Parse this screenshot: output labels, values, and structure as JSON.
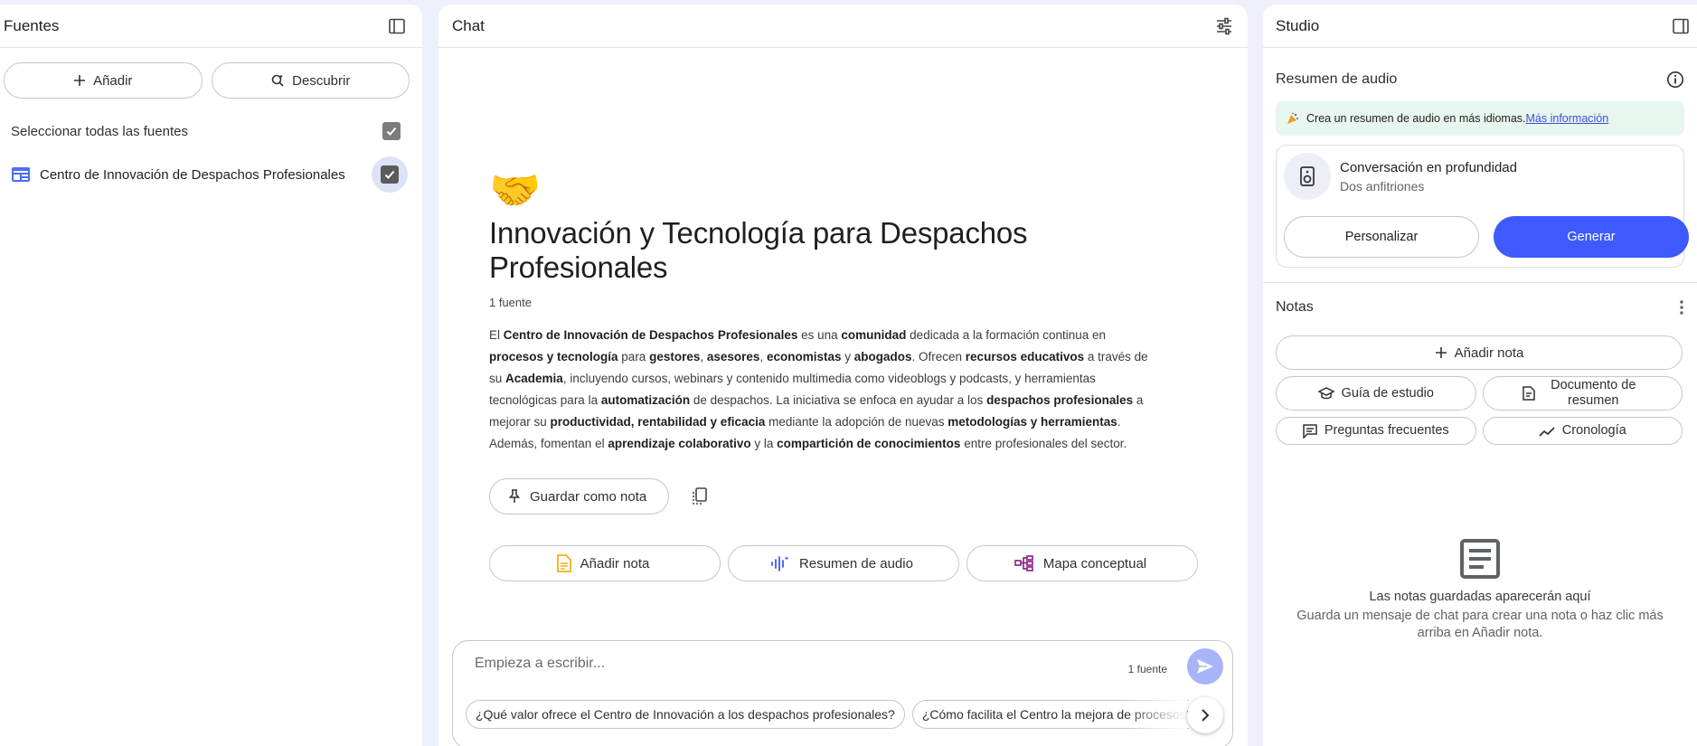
{
  "sources": {
    "title": "Fuentes",
    "add_label": "Añadir",
    "discover_label": "Descubrir",
    "select_all_label": "Seleccionar todas las fuentes",
    "items": [
      {
        "label": "Centro de Innovación de Despachos Profesionales",
        "checked": true
      }
    ]
  },
  "chat": {
    "title": "Chat",
    "emoji": "🤝",
    "notebook_title": "Innovación y Tecnología para Despachos Profesionales",
    "source_count": "1 fuente",
    "summary": [
      {
        "t": "El ",
        "b": false
      },
      {
        "t": "Centro de Innovación de Despachos Profesionales",
        "b": true
      },
      {
        "t": " es una ",
        "b": false
      },
      {
        "t": "comunidad",
        "b": true
      },
      {
        "t": " dedicada a la formación continua en ",
        "b": false
      },
      {
        "t": "procesos y tecnología",
        "b": true
      },
      {
        "t": " para ",
        "b": false
      },
      {
        "t": "gestores",
        "b": true
      },
      {
        "t": ", ",
        "b": false
      },
      {
        "t": "asesores",
        "b": true
      },
      {
        "t": ", ",
        "b": false
      },
      {
        "t": "economistas",
        "b": true
      },
      {
        "t": " y ",
        "b": false
      },
      {
        "t": "abogados",
        "b": true
      },
      {
        "t": ". Ofrecen ",
        "b": false
      },
      {
        "t": "recursos educativos",
        "b": true
      },
      {
        "t": " a través de su ",
        "b": false
      },
      {
        "t": "Academia",
        "b": true
      },
      {
        "t": ", incluyendo cursos, webinars y contenido multimedia como videoblogs y podcasts, y herramientas tecnológicas para la ",
        "b": false
      },
      {
        "t": "automatización",
        "b": true
      },
      {
        "t": " de despachos. La iniciativa se enfoca en ayudar a los ",
        "b": false
      },
      {
        "t": "despachos profesionales",
        "b": true
      },
      {
        "t": " a mejorar su ",
        "b": false
      },
      {
        "t": "productividad, rentabilidad y eficacia",
        "b": true
      },
      {
        "t": " mediante la adopción de nuevas ",
        "b": false
      },
      {
        "t": "metodologías y herramientas",
        "b": true
      },
      {
        "t": ". Además, fomentan el ",
        "b": false
      },
      {
        "t": "aprendizaje colaborativo",
        "b": true
      },
      {
        "t": " y la ",
        "b": false
      },
      {
        "t": "compartición de conocimientos",
        "b": true
      },
      {
        "t": " entre profesionales del sector.",
        "b": false
      }
    ],
    "save_note_label": "Guardar como nota",
    "quick_actions": [
      "Añadir nota",
      "Resumen de audio",
      "Mapa conceptual"
    ],
    "input_placeholder": "Empieza a escribir...",
    "input_source_count": "1 fuente",
    "suggestions": [
      "¿Qué valor ofrece el Centro de Innovación a los despachos profesionales?",
      "¿Cómo facilita el Centro la mejora de procesos?"
    ]
  },
  "studio": {
    "title": "Studio",
    "audio_section_title": "Resumen de audio",
    "banner_text": "Crea un resumen de audio en más idiomas.",
    "banner_link": "Más información",
    "audio_card": {
      "title": "Conversación en profundidad",
      "subtitle": "Dos anfitriones",
      "customize_label": "Personalizar",
      "generate_label": "Generar"
    },
    "notes_title": "Notas",
    "add_note_label": "Añadir nota",
    "note_buttons": [
      "Guía de estudio",
      "Documento de resumen",
      "Preguntas frecuentes",
      "Cronología"
    ],
    "empty_title": "Las notas guardadas aparecerán aquí",
    "empty_text": "Guarda un mensaje de chat para crear una nota o haz clic más arriba en Añadir nota."
  },
  "colors": {
    "accent": "#3d5afe",
    "send_disabled": "#a8b4f8",
    "banner_bg": "#e7f6ee",
    "background": "#eef0fb"
  }
}
